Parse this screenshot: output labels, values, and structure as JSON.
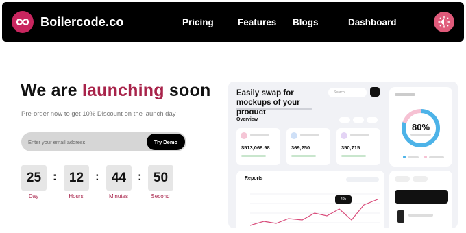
{
  "nav": {
    "brand": "Boilercode.co",
    "links": [
      "Pricing",
      "Features",
      "Blogs",
      "Dashboard"
    ]
  },
  "hero": {
    "title_prefix": "We are ",
    "title_accent": "launching",
    "title_suffix": " soon",
    "subtitle": "Pre-order now to get 10% Discount on the launch day",
    "email_placeholder": "Enter your email address",
    "cta_label": "Try Demo"
  },
  "countdown": [
    {
      "value": "25",
      "label": "Day"
    },
    {
      "value": "12",
      "label": "Hours"
    },
    {
      "value": "44",
      "label": "Minutes"
    },
    {
      "value": "50",
      "label": "Second"
    }
  ],
  "mockup": {
    "title": "Easily swap for mockups of your product",
    "search_placeholder": "Search",
    "overview_label": "Overview",
    "cards": [
      {
        "value": "$513,068.98",
        "dot_color": "#f5c6d6"
      },
      {
        "value": "369,250",
        "dot_color": "#cfe0f7"
      },
      {
        "value": "350,715",
        "dot_color": "#e4d4f5"
      }
    ],
    "analytics_value": "80%",
    "analytics_fraction": 0.8,
    "reports_label": "Reports",
    "reports_tooltip": "40k"
  },
  "colors": {
    "accent": "#a8234a",
    "brand_logo": "#c9265f",
    "theme_button": "#e05a7a",
    "gauge": "#4db3e8"
  }
}
